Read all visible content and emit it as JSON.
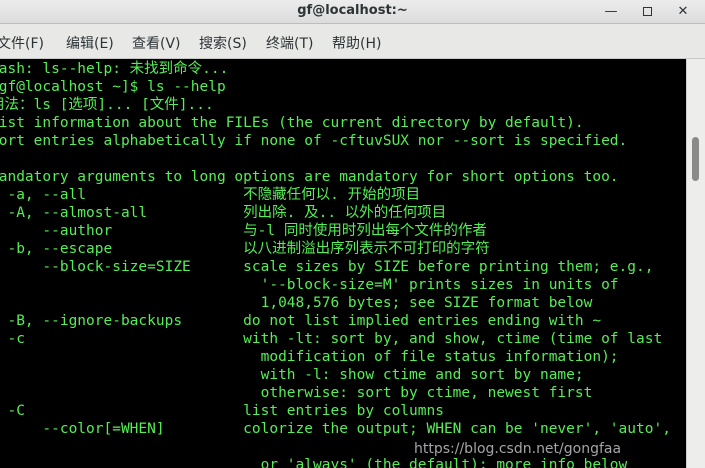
{
  "window": {
    "title": "gf@localhost:~",
    "minimize_glyph": "—",
    "close_glyph": "✕"
  },
  "menu": {
    "items": [
      {
        "label": "文件(F)"
      },
      {
        "label": "编辑(E)"
      },
      {
        "label": "查看(V)"
      },
      {
        "label": "搜索(S)"
      },
      {
        "label": "终端(T)"
      },
      {
        "label": "帮助(H)"
      }
    ]
  },
  "terminal": {
    "lines": [
      "bash: ls--help: 未找到命令...",
      "[gf@localhost ~]$ ls --help",
      "用法：ls [选项]... [文件]...",
      "List information about the FILEs (the current directory by default).",
      "Sort entries alphabetically if none of -cftuvSUX nor --sort is specified.",
      "",
      "Mandatory arguments to long options are mandatory for short options too.",
      "  -a, --all                  不隐藏任何以. 开始的项目",
      "  -A, --almost-all           列出除. 及.. 以外的任何项目",
      "      --author               与-l 同时使用时列出每个文件的作者",
      "  -b, --escape               以八进制溢出序列表示不可打印的字符",
      "      --block-size=SIZE      scale sizes by SIZE before printing them; e.g.,",
      "                               '--block-size=M' prints sizes in units of",
      "                               1,048,576 bytes; see SIZE format below",
      "  -B, --ignore-backups       do not list implied entries ending with ~",
      "  -c                         with -lt: sort by, and show, ctime (time of last",
      "                               modification of file status information);",
      "                               with -l: show ctime and sort by name;",
      "                               otherwise: sort by ctime, newest first",
      "  -C                         list entries by columns",
      "      --color[=WHEN]         colorize the output; WHEN can be 'never', 'auto',",
      "",
      "                               or 'always' (the default); more info below"
    ]
  },
  "watermark": "https://blog.csdn.net/gongfaa",
  "colors": {
    "terminal_fg": "#55ee55",
    "terminal_bg": "#000000",
    "titlebar_bg": "#e6e6e6",
    "menubar_bg": "#e8e8e7"
  }
}
